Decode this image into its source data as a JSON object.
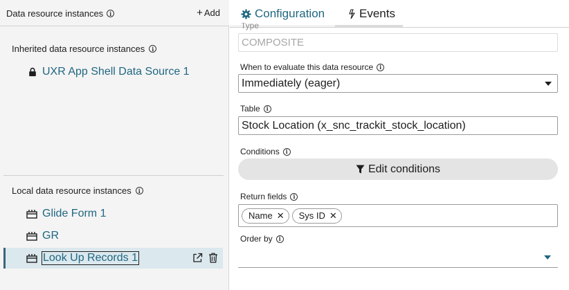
{
  "left": {
    "title": "Data resource instances",
    "add_label": "Add",
    "inherited_title": "Inherited data resource instances",
    "inherited_items": [
      {
        "label": "UXR App Shell Data Source 1",
        "icon": "lock-icon"
      }
    ],
    "local_title": "Local data resource instances",
    "local_items": [
      {
        "label": "Glide Form 1",
        "icon": "data-resource-icon"
      },
      {
        "label": "GR",
        "icon": "data-resource-icon"
      },
      {
        "label": "Look Up Records 1",
        "icon": "data-resource-icon",
        "selected": true
      }
    ]
  },
  "tabs": {
    "configuration": "Configuration",
    "events": "Events"
  },
  "form": {
    "type_label": "Type",
    "type_value": "COMPOSITE",
    "when_label": "When to evaluate this data resource",
    "when_value": "Immediately (eager)",
    "table_label": "Table",
    "table_value": "Stock Location (x_snc_trackit_stock_location)",
    "conditions_label": "Conditions",
    "edit_conditions": "Edit conditions",
    "return_label": "Return fields",
    "return_chips": [
      "Name",
      "Sys ID"
    ],
    "order_label": "Order by",
    "order_value": ""
  },
  "colors": {
    "accent": "#206780",
    "selected_bg": "#dbe8ee",
    "panel_bg": "#f4f4f4"
  }
}
